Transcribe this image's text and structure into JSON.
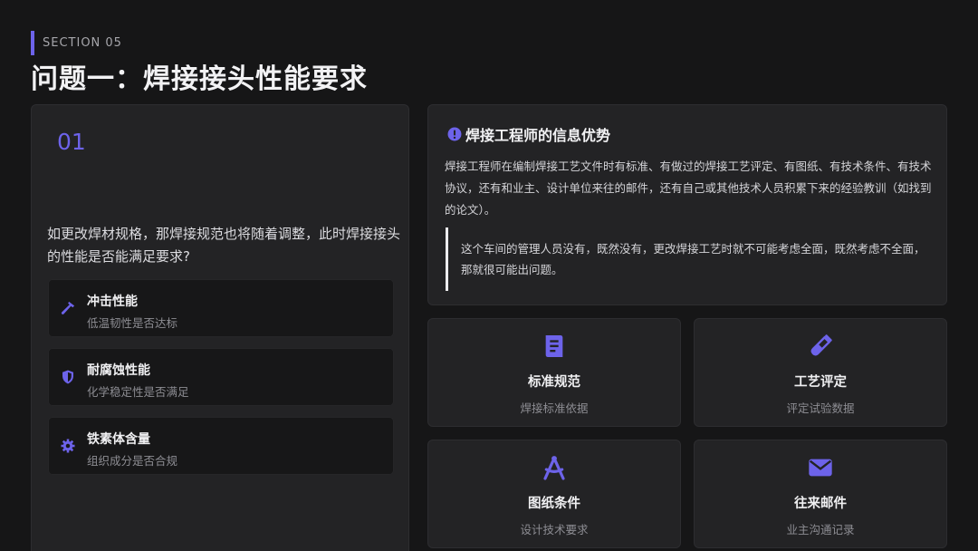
{
  "header": {
    "section": "SECTION 05",
    "title": "问题一：焊接接头性能要求"
  },
  "left": {
    "number": "01",
    "question": "如更改焊材规格，那焊接规范也将随着调整，此时焊接接头的性能是否能满足要求?",
    "items": [
      {
        "icon": "hammer-icon",
        "title": "冲击性能",
        "subtitle": "低温韧性是否达标"
      },
      {
        "icon": "shield-icon",
        "title": "耐腐蚀性能",
        "subtitle": "化学稳定性是否满足"
      },
      {
        "icon": "gear-icon",
        "title": "铁素体含量",
        "subtitle": "组织成分是否合规"
      }
    ]
  },
  "info": {
    "icon": "alert-circle-icon",
    "title": "焊接工程师的信息优势",
    "body": "焊接工程师在编制焊接工艺文件时有标准、有做过的焊接工艺评定、有图纸、有技术条件、有技术协议，还有和业主、设计单位来往的邮件，还有自己或其他技术人员积累下来的经验教训（如找到的论文）。",
    "quote": "这个车间的管理人员没有，既然没有，更改焊接工艺时就不可能考虑全面，既然考虑不全面，那就很可能出问题。"
  },
  "tiles": [
    {
      "icon": "book-icon",
      "title": "标准规范",
      "subtitle": "焊接标准依据"
    },
    {
      "icon": "test-tube-icon",
      "title": "工艺评定",
      "subtitle": "评定试验数据"
    },
    {
      "icon": "drafting-compass-icon",
      "title": "图纸条件",
      "subtitle": "设计技术要求"
    },
    {
      "icon": "envelope-icon",
      "title": "往来邮件",
      "subtitle": "业主沟通记录"
    }
  ],
  "colors": {
    "accent": "#6d63ea",
    "background": "#161617",
    "card": "#232325"
  }
}
